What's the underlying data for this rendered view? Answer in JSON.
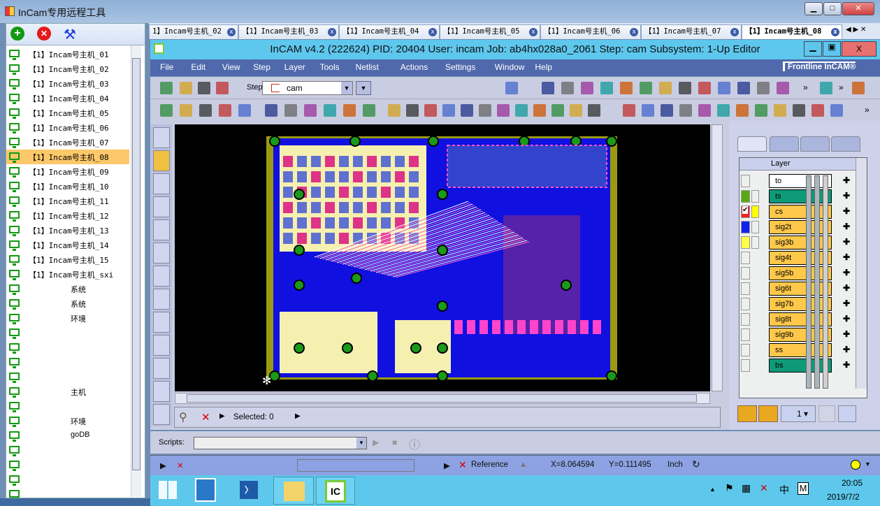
{
  "outer_window": {
    "title": "InCam专用远程工具",
    "min": "▁",
    "max": "□",
    "close": "✕"
  },
  "left_toolbar": {
    "add": "+",
    "remove": "✕",
    "settings": "wrench"
  },
  "hosts": [
    {
      "label": "【1】Incam号主机_01"
    },
    {
      "label": "【1】Incam号主机_02"
    },
    {
      "label": "【1】Incam号主机_03"
    },
    {
      "label": "【1】Incam号主机_04"
    },
    {
      "label": "【1】Incam号主机_05"
    },
    {
      "label": "【1】Incam号主机_06"
    },
    {
      "label": "【1】Incam号主机_07"
    },
    {
      "label": "【1】Incam号主机_08",
      "selected": true
    },
    {
      "label": "【1】Incam号主机_09"
    },
    {
      "label": "【1】Incam号主机_10"
    },
    {
      "label": "【1】Incam号主机_11"
    },
    {
      "label": "【1】Incam号主机_12"
    },
    {
      "label": "【1】Incam号主机_13"
    },
    {
      "label": "【1】Incam号主机_14"
    },
    {
      "label": "【1】Incam号主机_15"
    },
    {
      "label": "【1】Incam号主机_sxi"
    },
    {
      "label2": "系统"
    },
    {
      "label2": "系统"
    },
    {
      "label2": "环境"
    },
    {
      "label2": ""
    },
    {
      "label2": ""
    },
    {
      "label2": ""
    },
    {
      "label2": ""
    },
    {
      "label2": "主机"
    },
    {
      "label2": ""
    },
    {
      "label2": "环境"
    },
    {
      "label2": "goDB"
    },
    {
      "label2": ""
    },
    {
      "label2": ""
    },
    {
      "label2": ""
    },
    {
      "label2": ""
    }
  ],
  "tabs": [
    {
      "label": "1】Incam号主机_02"
    },
    {
      "label": "【1】Incam号主机_03"
    },
    {
      "label": "【1】Incam号主机_04"
    },
    {
      "label": "【1】Incam号主机_05"
    },
    {
      "label": "【1】Incam号主机_06"
    },
    {
      "label": "【1】Incam号主机_07"
    },
    {
      "label": "【1】Incam号主机_08",
      "active": true
    }
  ],
  "tab_nav": "◀ ▶ ✕",
  "incam": {
    "title": "InCAM  v4.2 (222624)  PID: 20404  User: incam  Job: ab4hx028a0_2061  Step: cam  Subsystem: 1-Up Editor",
    "menu": [
      "File",
      "Edit",
      "View",
      "Step",
      "Layer",
      "Tools",
      "Netlist",
      "Actions",
      "Settings",
      "Window",
      "Help"
    ],
    "logo": "Frontline InCAM®",
    "step_label": "Step",
    "step_value": "cam",
    "more": "»"
  },
  "selected_text": "Selected: 0",
  "layer_panel": {
    "header": "Layer",
    "page": "1",
    "layers": [
      {
        "name": "to",
        "color": "#ffffff"
      },
      {
        "name": "ts",
        "color": "#0e9a78",
        "mark": "#55aa11"
      },
      {
        "name": "cs",
        "color": "#ffc84a",
        "mark": "#ee2222",
        "checked": true
      },
      {
        "name": "sig2t",
        "color": "#ffc84a",
        "mark": "#1122ee"
      },
      {
        "name": "sig3b",
        "color": "#ffc84a",
        "mark": "#ffff44"
      },
      {
        "name": "sig4t",
        "color": "#ffc84a"
      },
      {
        "name": "sig5b",
        "color": "#ffc84a"
      },
      {
        "name": "sig6t",
        "color": "#ffc84a"
      },
      {
        "name": "sig7b",
        "color": "#ffc84a"
      },
      {
        "name": "sig8t",
        "color": "#ffc84a"
      },
      {
        "name": "sig9b",
        "color": "#ffc84a"
      },
      {
        "name": "ss",
        "color": "#ffc84a"
      },
      {
        "name": "bs",
        "color": "#0e9a78"
      }
    ]
  },
  "scripts": {
    "label": "Scripts:",
    "value": ""
  },
  "status": {
    "reference": "Reference",
    "x": "X=8.064594",
    "y": "Y=0.111495",
    "units": "Inch"
  },
  "taskbar": {
    "time": "20:05",
    "date": "2019/7/2",
    "ime": "中",
    "m": "M",
    "incam_app": "IC"
  }
}
